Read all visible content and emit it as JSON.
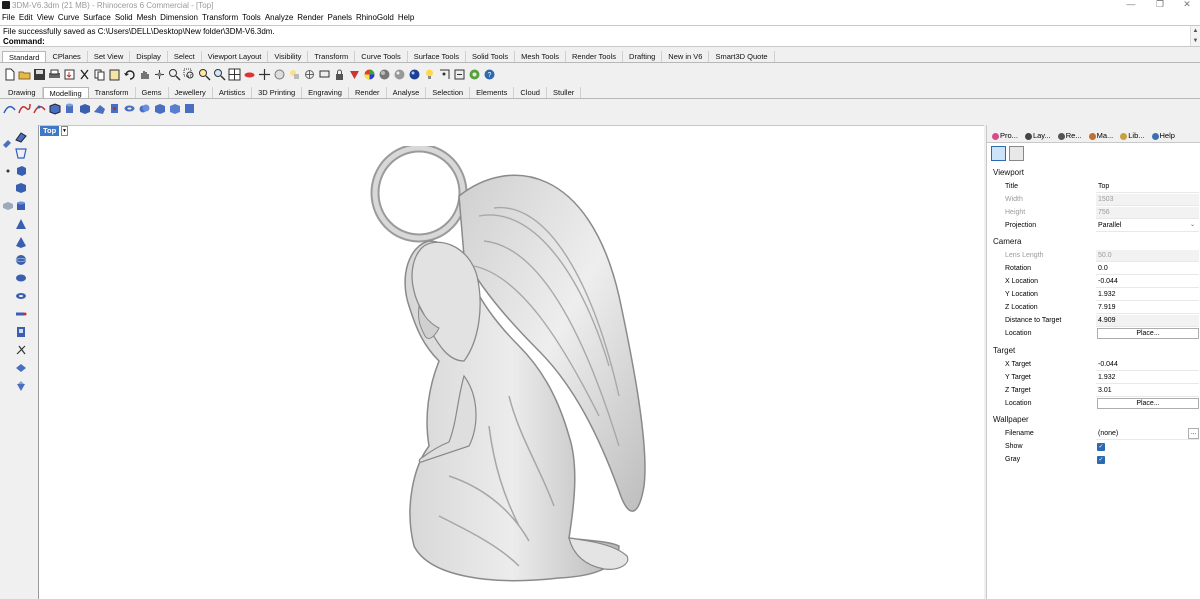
{
  "window": {
    "title": "3DM-V6.3dm (21 MB) - Rhinoceros 6 Commercial - [Top]",
    "minimize": "—",
    "maximize": "❐",
    "close": "✕"
  },
  "menu": [
    "File",
    "Edit",
    "View",
    "Curve",
    "Surface",
    "Solid",
    "Mesh",
    "Dimension",
    "Transform",
    "Tools",
    "Analyze",
    "Render",
    "Panels",
    "RhinoGold",
    "Help"
  ],
  "command": {
    "history": "File successfully saved as C:\\Users\\DELL\\Desktop\\New folder\\3DM-V6.3dm.",
    "prompt": "Command:",
    "value": ""
  },
  "toolbar_tabs_1": [
    "Standard",
    "CPlanes",
    "Set View",
    "Display",
    "Select",
    "Viewport Layout",
    "Visibility",
    "Transform",
    "Curve Tools",
    "Surface Tools",
    "Solid Tools",
    "Mesh Tools",
    "Render Tools",
    "Drafting",
    "New in V6",
    "Smart3D Quote"
  ],
  "toolbar_tabs_2": [
    "Drawing",
    "Modelling",
    "Transform",
    "Gems",
    "Jewellery",
    "Artistics",
    "3D Printing",
    "Engraving",
    "Render",
    "Analyse",
    "Selection",
    "Elements",
    "Cloud",
    "Stuller"
  ],
  "viewport": {
    "name": "Top",
    "dropdown_glyph": "▼"
  },
  "panel": {
    "tabs": [
      {
        "label": "Pro...",
        "color": "#d94a8a"
      },
      {
        "label": "Lay...",
        "color": "#444444"
      },
      {
        "label": "Re...",
        "color": "#555555"
      },
      {
        "label": "Ma...",
        "color": "#c07030"
      },
      {
        "label": "Lib...",
        "color": "#c8a040"
      },
      {
        "label": "Help",
        "color": "#3a6fb5"
      }
    ],
    "sections": {
      "viewport": "Viewport",
      "camera": "Camera",
      "target": "Target",
      "wallpaper": "Wallpaper"
    },
    "viewport_rows": [
      {
        "label": "Title",
        "value": "Top"
      },
      {
        "label": "Width",
        "value": "1503"
      },
      {
        "label": "Height",
        "value": "756"
      },
      {
        "label": "Projection",
        "value": "Parallel"
      }
    ],
    "camera_rows": [
      {
        "label": "Lens Length",
        "value": "50.0"
      },
      {
        "label": "Rotation",
        "value": "0.0"
      },
      {
        "label": "X Location",
        "value": "-0.044"
      },
      {
        "label": "Y Location",
        "value": "1.932"
      },
      {
        "label": "Z Location",
        "value": "7.919"
      },
      {
        "label": "Distance to Target",
        "value": "4.909"
      },
      {
        "label": "Location",
        "value": "Place..."
      }
    ],
    "target_rows": [
      {
        "label": "X Target",
        "value": "-0.044"
      },
      {
        "label": "Y Target",
        "value": "1.932"
      },
      {
        "label": "Z Target",
        "value": "3.01"
      },
      {
        "label": "Location",
        "value": "Place..."
      }
    ],
    "wallpaper_rows": [
      {
        "label": "Filename",
        "value": "(none)",
        "browse": "..."
      },
      {
        "label": "Show",
        "check": "✓"
      },
      {
        "label": "Gray",
        "check": "✓"
      }
    ],
    "projection_dropdown_glyph": "⌄"
  },
  "colors": {
    "accent": "#3d79c8",
    "checkbox": "#2c69b0"
  }
}
